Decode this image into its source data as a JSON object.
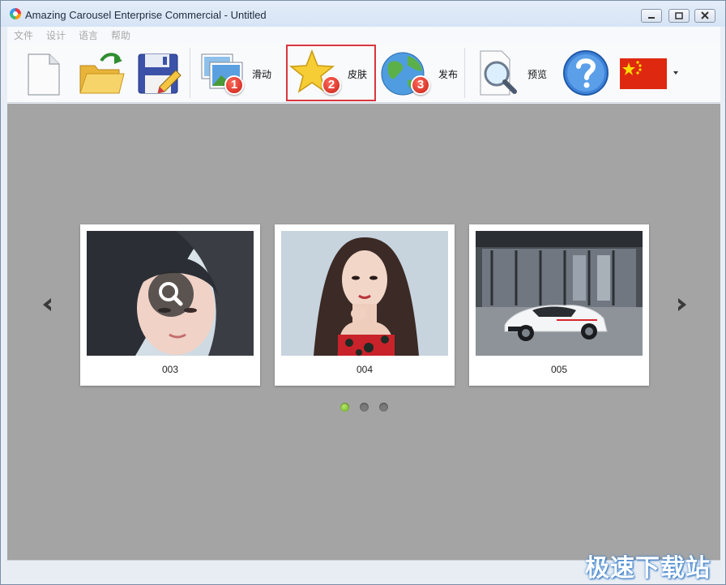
{
  "window": {
    "title": "Amazing Carousel Enterprise Commercial - Untitled"
  },
  "menu": {
    "items": [
      "文件",
      "设计",
      "语言",
      "帮助"
    ]
  },
  "toolbar": {
    "new_icon": "new-document-icon",
    "open_icon": "open-folder-icon",
    "save_icon": "save-icon",
    "slides_label": "滑动",
    "slides_badge": "1",
    "skin_label": "皮肤",
    "skin_badge": "2",
    "publish_label": "发布",
    "publish_badge": "3",
    "preview_label": "预览",
    "help_icon": "help-icon",
    "language_icon": "china-flag-icon",
    "dropdown_icon": "dropdown-arrow-icon",
    "highlight_color": "#d9373e"
  },
  "carousel": {
    "background": "#a4a4a4",
    "items": [
      {
        "caption": "003"
      },
      {
        "caption": "004"
      },
      {
        "caption": "005"
      }
    ],
    "pager": {
      "count": 3,
      "active": 0
    }
  },
  "watermark": "极速下载站"
}
